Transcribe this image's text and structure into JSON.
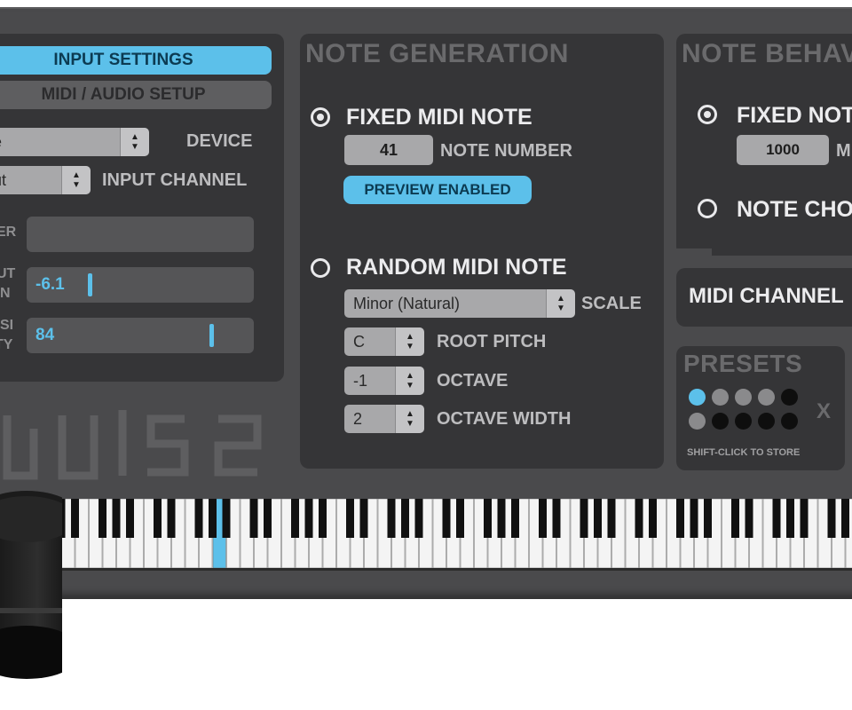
{
  "input": {
    "tabs": [
      {
        "label": "INPUT SETTINGS",
        "active": true
      },
      {
        "label": "MIDI / AUDIO SETUP",
        "active": false
      }
    ],
    "device_value": "ire",
    "device_label": "DEVICE",
    "channel_value": "put",
    "channel_label": "INPUT CHANNEL",
    "row1_label": "ER",
    "row2_label_line1": "UT",
    "row2_label_line2": "N",
    "row2_value": "-6.1",
    "row2_level": 0.25,
    "row3_label_line1": "SI",
    "row3_label_line2": "TY",
    "row3_value": "84",
    "row3_level": 0.83,
    "logo_text": "pulse"
  },
  "note_generation": {
    "title": "NOTE GENERATION",
    "fixed_label": "FIXED MIDI NOTE",
    "fixed_selected": true,
    "note_number_value": "41",
    "note_number_label": "NOTE NUMBER",
    "preview_label": "PREVIEW ENABLED",
    "random_label": "RANDOM MIDI NOTE",
    "random_selected": false,
    "scale_value": "Minor (Natural)",
    "scale_label": "SCALE",
    "root_value": "C",
    "root_label": "ROOT PITCH",
    "octave_value": "-1",
    "octave_label": "OCTAVE",
    "width_value": "2",
    "width_label": "OCTAVE WIDTH"
  },
  "note_behavior": {
    "title": "NOTE BEHAV",
    "fixed_label": "FIXED NOT",
    "fixed_selected": true,
    "ms_value": "1000",
    "ms_label": "M",
    "choke_label": "NOTE CHO",
    "choke_selected": false,
    "midi_channel_label": "MIDI CHANNEL"
  },
  "presets": {
    "title": "PRESETS",
    "clear_label": "X",
    "hint": "SHIFT-CLICK TO STORE"
  },
  "keyboard": {
    "highlight_white_key_index": 12
  },
  "colors": {
    "accent": "#5cc0ea",
    "panel": "#353537",
    "body": "#4a4a4c"
  }
}
